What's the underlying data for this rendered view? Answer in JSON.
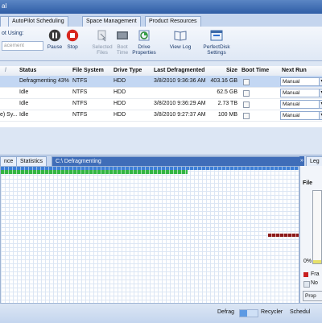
{
  "window": {
    "title": "al"
  },
  "tabs": [
    "AutoPilot Scheduling",
    "Space Management",
    "Product Resources"
  ],
  "ribbon": {
    "defrag_label": "ot Using:",
    "defrag_method_placeholder": "acement",
    "pause_label": "Pause",
    "stop_label": "Stop",
    "selected_files_label": "Selected Files",
    "boot_time_label": "Boot Time",
    "drive_properties_label": "Drive Properties",
    "view_log_label": "View Log",
    "perfectdisk_settings_label": "PerfectDisk Settings"
  },
  "grid": {
    "columns": [
      "Status",
      "File System",
      "Drive Type",
      "Last Defragmented",
      "Size",
      "Boot Time",
      "Next Run"
    ],
    "rows": [
      {
        "status": "Defragmenting 43%",
        "fs": "NTFS",
        "type": "HDD",
        "last": "3/8/2010 9:36:36 AM",
        "size": "403.16 GB",
        "next": "Manual",
        "selected": true
      },
      {
        "status": "Idle",
        "fs": "NTFS",
        "type": "HDD",
        "last": "",
        "size": "62.5 GB",
        "next": "Manual"
      },
      {
        "status": "Idle",
        "fs": "NTFS",
        "type": "HDD",
        "last": "3/8/2010 9:36:29 AM",
        "size": "2.73 TB",
        "next": "Manual"
      },
      {
        "status": "Idle",
        "fs": "NTFS",
        "type": "HDD",
        "last": "3/8/2010 9:27:37 AM",
        "size": "100 MB",
        "next": "Manual",
        "prefix": "e) Sy..."
      }
    ]
  },
  "lower_tabs": {
    "tab1": "nce",
    "tab2": "Statistics",
    "tab3": "C:\\ Defragmenting"
  },
  "legend": {
    "title": "Leg",
    "file_label": "File",
    "percent": "0%",
    "frag_label": "Fra",
    "nonfrag_label": "No",
    "props_label": "Prop"
  },
  "statusbar": {
    "defrag": "Defrag",
    "recycler": "Recycler",
    "schedule": "Schedul"
  },
  "progress": {
    "fraction": 0.43
  }
}
